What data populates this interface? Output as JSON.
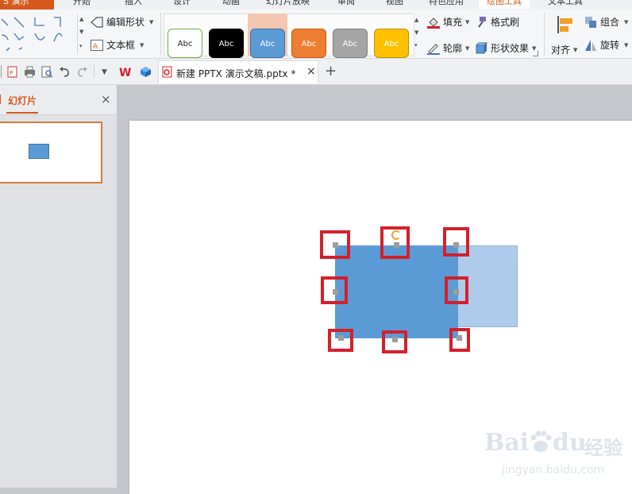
{
  "menubar": {
    "brand": "S 演示",
    "tabs": [
      {
        "label": "开始"
      },
      {
        "label": "插入"
      },
      {
        "label": "设计"
      },
      {
        "label": "动画"
      },
      {
        "label": "幻灯片放映"
      },
      {
        "label": "审阅"
      },
      {
        "label": "视图"
      },
      {
        "label": "特色应用"
      },
      {
        "label": "绘图工具"
      },
      {
        "label": "文本工具"
      }
    ],
    "active_tab": "绘图工具"
  },
  "ribbon": {
    "edit_shape": "编辑形状",
    "text_box": "文本框",
    "styles": [
      {
        "text": "Abc",
        "bg": "#ffffff",
        "border": "#70ad47",
        "color": "#222222"
      },
      {
        "text": "Abc",
        "bg": "#000000",
        "border": "#000000",
        "color": "#ffffff"
      },
      {
        "text": "Abc",
        "bg": "#5b9bd5",
        "border": "#41719c",
        "color": "#ffffff"
      },
      {
        "text": "Abc",
        "bg": "#ed7d31",
        "border": "#c55a11",
        "color": "#ffffff"
      },
      {
        "text": "Abc",
        "bg": "#a5a5a5",
        "border": "#7f7f7f",
        "color": "#ffffff"
      },
      {
        "text": "Abc",
        "bg": "#ffc000",
        "border": "#bf9000",
        "color": "#ffffff"
      }
    ],
    "fill": "填充",
    "format_brush": "格式刷",
    "outline": "轮廓",
    "shape_effects": "形状效果",
    "align": "对齐",
    "group": "组合",
    "rotate": "旋转"
  },
  "tabs_bar": {
    "document_title": "新建 PPTX 演示文稿.pptx *",
    "close": "×",
    "new_tab": "+"
  },
  "left_panel": {
    "tab_label": "幻灯片",
    "close": "×"
  },
  "watermark": {
    "brand": "Bai",
    "brand2": "du",
    "chinese": "经验",
    "url": "jingyan.baidu.com"
  },
  "colors": {
    "accent": "#d65a1e",
    "shape_fill": "#5b9bd5",
    "shape_ghost": "#aecbeb",
    "highlight_box": "#d4202c"
  }
}
